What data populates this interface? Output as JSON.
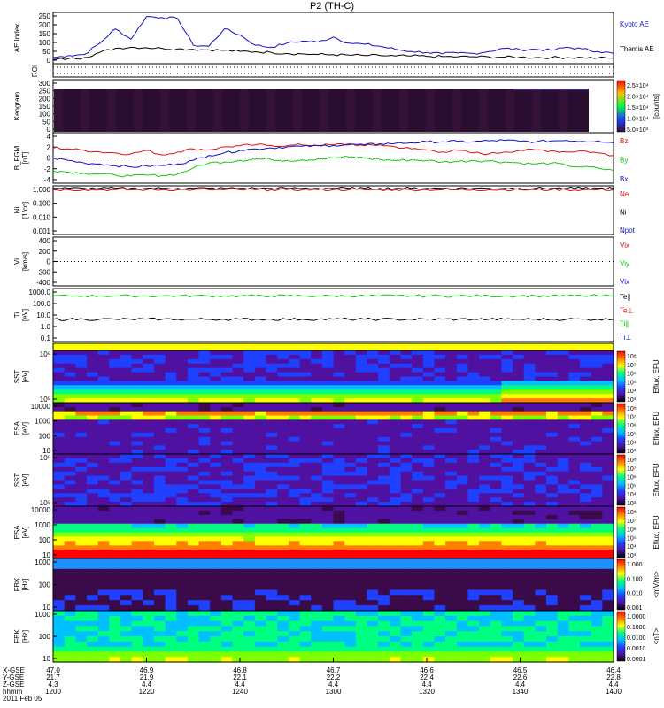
{
  "title": "P2 (TH-C)",
  "colors": {
    "blue": "#1010c8",
    "red": "#d81010",
    "green": "#10c810",
    "black": "#000000",
    "bg": "#ffffff",
    "dark": "#28102e"
  },
  "chart_data": [
    {
      "type": "line",
      "panel": "ae",
      "ylabel": "AE Index",
      "yticks": [
        "250",
        "200",
        "150",
        "100",
        "50",
        "0"
      ],
      "ylim": [
        0,
        250
      ],
      "x": [
        "1200",
        "1220",
        "1240",
        "1300",
        "1320",
        "1340",
        "1400"
      ],
      "series": [
        {
          "name": "Kyoto AE",
          "color": "#1010c8",
          "values": [
            30,
            40,
            45,
            100,
            170,
            120,
            230,
            225,
            220,
            90,
            85,
            170,
            140,
            90,
            80,
            100,
            110,
            105,
            130,
            100,
            95,
            85,
            70,
            60,
            55,
            48,
            52,
            50,
            60,
            75,
            68,
            70,
            65,
            80,
            72,
            60,
            50
          ]
        },
        {
          "name": "Themis AE",
          "color": "#000000",
          "values": [
            20,
            25,
            30,
            55,
            75,
            80,
            78,
            75,
            72,
            70,
            68,
            65,
            60,
            58,
            55,
            50,
            48,
            45,
            44,
            42,
            40,
            40,
            38,
            38,
            36,
            35,
            34,
            34,
            33,
            32,
            32,
            30,
            30,
            30,
            30,
            28,
            28
          ]
        }
      ]
    },
    {
      "type": "line",
      "panel": "roi",
      "ylabel": "ROI"
    },
    {
      "type": "heatmap",
      "panel": "keogram",
      "ylabel": "Keogram",
      "yticks": [
        "300",
        "250",
        "200",
        "150",
        "100",
        "50",
        "0"
      ],
      "colorbar": {
        "label": "[counts]",
        "ticks": [
          "2.5×10⁴",
          "2.0×10⁴",
          "1.5×10⁴",
          "1.0×10⁴",
          "5.0×10³"
        ]
      }
    },
    {
      "type": "line",
      "panel": "bfgm",
      "ylabel": "B_FGM",
      "units": "[nT]",
      "yticks": [
        "4",
        "2",
        "0",
        "-2",
        "-4"
      ],
      "ylim": [
        -5,
        5
      ],
      "series": [
        {
          "name": "Bz",
          "color": "#d81010",
          "values": [
            2,
            1.8,
            1.5,
            1.2,
            1,
            0.8,
            1.5,
            0.6,
            1.2,
            1.8,
            1.6,
            2.2,
            2.4,
            2.6,
            2.5,
            2.4,
            2.6,
            2.5,
            2.6,
            2.8,
            2.4,
            2.6,
            2.2,
            1.8,
            1.6,
            1.2,
            1.5,
            1,
            0.8,
            1.2,
            1.5,
            1.6,
            1.4,
            1.2,
            1.4,
            1,
            0.5
          ]
        },
        {
          "name": "By",
          "color": "#10c810",
          "values": [
            -2.5,
            -2.8,
            -3,
            -3.2,
            -3.4,
            -3.6,
            -3.4,
            -3.5,
            -3.2,
            -2,
            -1,
            -0.8,
            -0.5,
            -0.2,
            -0.3,
            -0.5,
            -0.4,
            -0.2,
            0,
            0.2,
            0,
            -0.3,
            -0.5,
            -0.4,
            -0.5,
            -0.8,
            -0.7,
            -0.5,
            -0.6,
            -0.8,
            -1,
            -1.2,
            -1,
            -1.5,
            -1.8,
            -2,
            -2.5
          ]
        },
        {
          "name": "Bx",
          "color": "#1010c8",
          "values": [
            0,
            -0.5,
            -1,
            -1.2,
            -1.5,
            -1.8,
            -1.6,
            -1.5,
            -1.2,
            -0.5,
            0.5,
            1,
            1.5,
            1.8,
            2,
            2.2,
            2.3,
            2.4,
            2.5,
            2.6,
            2.6,
            2.8,
            2.9,
            3,
            3.2,
            3.2,
            3.3,
            3.2,
            3.4,
            3.5,
            3.3,
            3.2,
            3.4,
            3.5,
            3.3,
            3.4,
            3
          ]
        }
      ]
    },
    {
      "type": "line",
      "panel": "ni",
      "ylabel": "Ni",
      "units": "[1/cc]",
      "yticks": [
        "1.000",
        "0.100",
        "0.010",
        "0.001"
      ],
      "legend": [
        "Ne",
        "Ni",
        "Npot"
      ]
    },
    {
      "type": "line",
      "panel": "vi",
      "ylabel": "Vi",
      "units": "[km/s]",
      "yticks": [
        "400",
        "200",
        "0",
        "-200",
        "-400"
      ],
      "legend": [
        "Vix",
        "Viy",
        "Vix"
      ]
    },
    {
      "type": "line",
      "panel": "ti",
      "ylabel": "Ti",
      "units": "[eV]",
      "yticks": [
        "1000.0",
        "100.0",
        "10.0",
        "1.0",
        "0.1"
      ],
      "legend": [
        "Te∥",
        "Te⊥",
        "Ti∥",
        "Ti⊥"
      ]
    },
    {
      "type": "heatmap",
      "panel": "sst1",
      "ylabel": "SST",
      "units": "[eV]",
      "yticks": [
        "10⁶",
        "10⁵"
      ],
      "colorbar": {
        "label": "Eflux, EFU",
        "ticks": [
          "10⁸",
          "10⁷",
          "10⁶",
          "10⁵",
          "10⁴",
          "10³"
        ]
      }
    },
    {
      "type": "heatmap",
      "panel": "esa1",
      "ylabel": "ESA",
      "units": "[eV]",
      "yticks": [
        "10000",
        "1000",
        "100",
        "10"
      ],
      "colorbar": {
        "label": "Eflux, EFU",
        "ticks": [
          "10⁸",
          "10⁷",
          "10⁶",
          "10⁵",
          "10⁴",
          "10³"
        ]
      }
    },
    {
      "type": "heatmap",
      "panel": "sst2",
      "ylabel": "SST",
      "units": "[eV]",
      "yticks": [
        "10⁶",
        "10⁵"
      ],
      "colorbar": {
        "label": "Eflux, EFU",
        "ticks": [
          "10⁸",
          "10⁷",
          "10⁶",
          "10⁵",
          "10⁴",
          "10³"
        ]
      }
    },
    {
      "type": "heatmap",
      "panel": "esa2",
      "ylabel": "ESA",
      "units": "[eV]",
      "yticks": [
        "10000",
        "1000",
        "100",
        "10"
      ],
      "colorbar": {
        "label": "Eflux, EFU",
        "ticks": [
          "10⁸",
          "10⁷",
          "10⁶",
          "10⁵",
          "10⁴",
          "10³"
        ]
      }
    },
    {
      "type": "heatmap",
      "panel": "fbk1",
      "ylabel": "FBK",
      "units": "[Hz]",
      "yticks": [
        "1000",
        "100",
        "10"
      ],
      "colorbar": {
        "label": "<mV/m>",
        "ticks": [
          "1.000",
          "0.100",
          "0.010",
          "0.001"
        ]
      }
    },
    {
      "type": "heatmap",
      "panel": "fbk2",
      "ylabel": "FBK",
      "units": "[Hz]",
      "yticks": [
        "1000",
        "100",
        "10"
      ],
      "colorbar": {
        "label": "<nT>",
        "ticks": [
          "1.0000",
          "0.1000",
          "0.0100",
          "0.0010",
          "0.0001"
        ]
      }
    }
  ],
  "ephem": {
    "labels": [
      "X-GSE",
      "Y-GSE",
      "Z-GSE",
      "hhmm",
      "2011 Feb 05"
    ],
    "cols": [
      [
        "47.0",
        "21.7",
        "4.3",
        "1200"
      ],
      [
        "46.9",
        "21.9",
        "4.4",
        "1220"
      ],
      [
        "46.8",
        "22.1",
        "4.4",
        "1240"
      ],
      [
        "46.7",
        "22.2",
        "4.4",
        "1300"
      ],
      [
        "46.6",
        "22.4",
        "4.4",
        "1320"
      ],
      [
        "46.5",
        "22.6",
        "4.4",
        "1340"
      ],
      [
        "46.4",
        "22.8",
        "4.4",
        "1400"
      ]
    ]
  }
}
